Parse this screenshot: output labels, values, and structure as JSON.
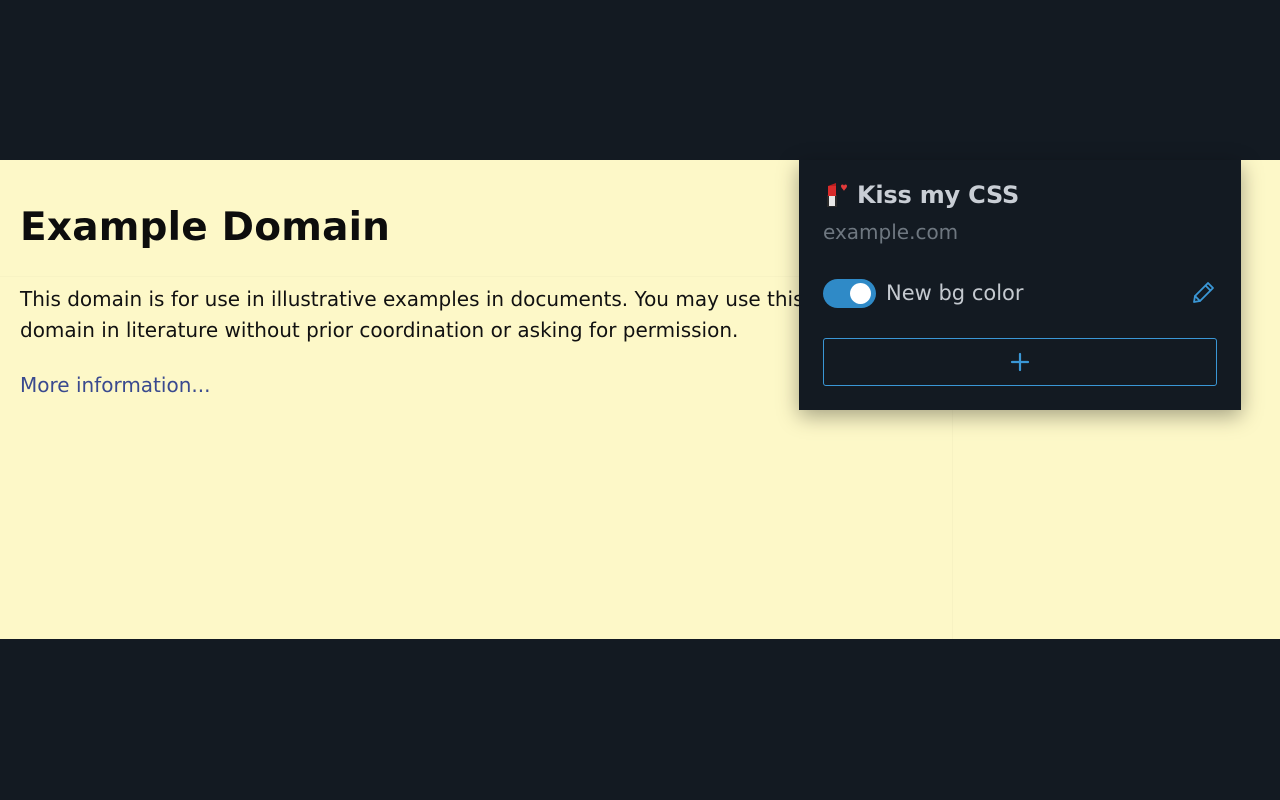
{
  "page": {
    "heading": "Example Domain",
    "paragraph": "This domain is for use in illustrative examples in documents. You may use this domain in literature without prior coordination or asking for permission.",
    "link": "More information...",
    "background_color": "#fdf8c8"
  },
  "popup": {
    "title": "Kiss my CSS",
    "domain": "example.com",
    "logo_icon": "lipstick-icon",
    "rules": [
      {
        "label": "New bg color",
        "enabled": true,
        "edit_icon": "pencil-icon"
      }
    ],
    "add_button_icon": "plus-icon",
    "accent_color": "#2f8ac7",
    "background_color": "#131a22"
  }
}
